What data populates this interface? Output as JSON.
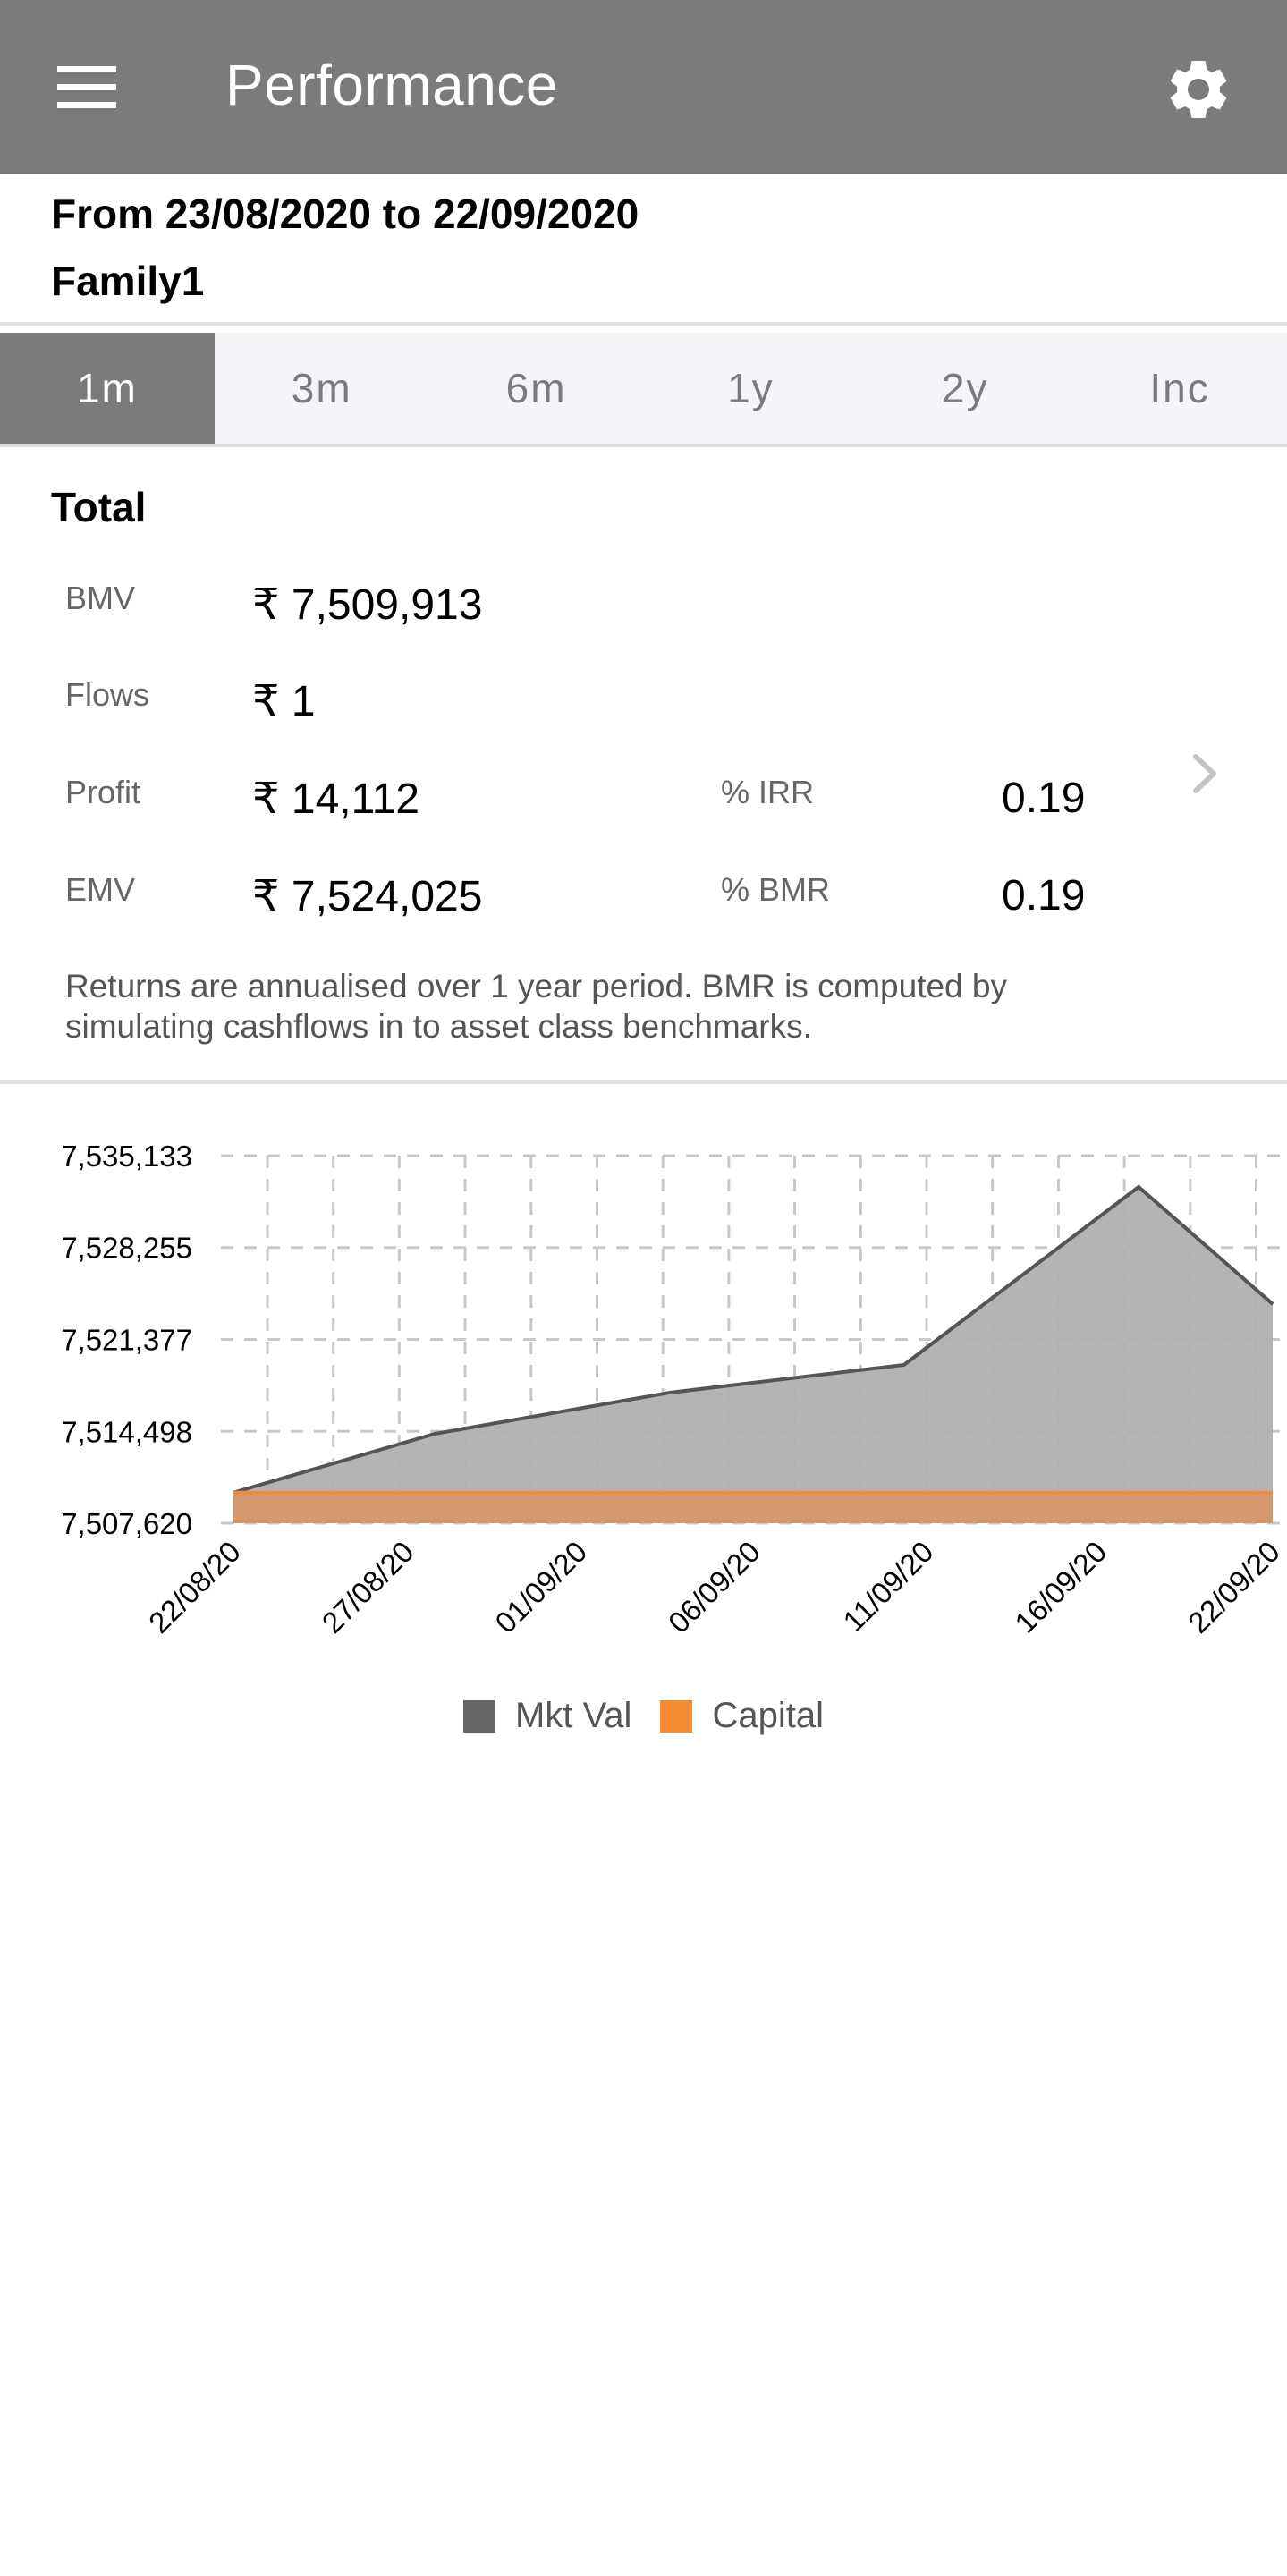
{
  "appbar": {
    "title": "Performance",
    "menu_icon": "hamburger-menu-icon",
    "settings_icon": "gear-icon"
  },
  "header": {
    "period": "From 23/08/2020 to 22/09/2020",
    "family": "Family1"
  },
  "tabs": [
    {
      "label": "1m",
      "active": true
    },
    {
      "label": "3m",
      "active": false
    },
    {
      "label": "6m",
      "active": false
    },
    {
      "label": "1y",
      "active": false
    },
    {
      "label": "2y",
      "active": false
    },
    {
      "label": "Inc",
      "active": false
    }
  ],
  "summary": {
    "title": "Total",
    "bmv": {
      "label": "BMV",
      "value": "₹ 7,509,913"
    },
    "flows": {
      "label": "Flows",
      "value": "₹ 1"
    },
    "profit": {
      "label": "Profit",
      "value": "₹ 14,112"
    },
    "emv": {
      "label": "EMV",
      "value": "₹ 7,524,025"
    },
    "irr": {
      "label": "% IRR",
      "value": "0.19"
    },
    "bmr": {
      "label": "% BMR",
      "value": "0.19"
    },
    "note": "Returns are annualised over 1 year period. BMR is computed by simulating cashflows in to asset class benchmarks."
  },
  "colors": {
    "appbar": "#7a7b7d",
    "mkt_val_fill": "#b0b0b0",
    "mkt_val_line": "#555555",
    "capital_fill": "#d49a6e",
    "capital_line": "#f08a3c",
    "legend_mkt": "#666666",
    "legend_capital": "#f68b33"
  },
  "chart_data": {
    "type": "area",
    "title": "",
    "xlabel": "",
    "ylabel": "",
    "x_ticks": [
      "22/08/20",
      "27/08/20",
      "01/09/20",
      "06/09/20",
      "11/09/20",
      "16/09/20",
      "22/09/20"
    ],
    "y_ticks": [
      7507620,
      7514498,
      7521377,
      7528255,
      7535133
    ],
    "y_tick_labels": [
      "7,507,620",
      "7,514,498",
      "7,521,377",
      "7,528,255",
      "7,535,133"
    ],
    "ylim": [
      7507620,
      7535133
    ],
    "x_range_days": [
      0,
      31
    ],
    "grid": true,
    "legend": "bottom-center",
    "series": [
      {
        "name": "Mkt Val",
        "points": [
          {
            "day": 0,
            "date": "22/08/20",
            "value": 7509913
          },
          {
            "day": 6,
            "date": "28/08/20",
            "value": 7514310
          },
          {
            "day": 13,
            "date": "04/09/20",
            "value": 7517390
          },
          {
            "day": 20,
            "date": "11/09/20",
            "value": 7519470
          },
          {
            "day": 27,
            "date": "18/09/20",
            "value": 7532790
          },
          {
            "day": 31,
            "date": "22/09/20",
            "value": 7524025
          }
        ]
      },
      {
        "name": "Capital",
        "points": [
          {
            "day": 0,
            "date": "22/08/20",
            "value": 7509914
          },
          {
            "day": 31,
            "date": "22/09/20",
            "value": 7509914
          }
        ]
      }
    ]
  }
}
